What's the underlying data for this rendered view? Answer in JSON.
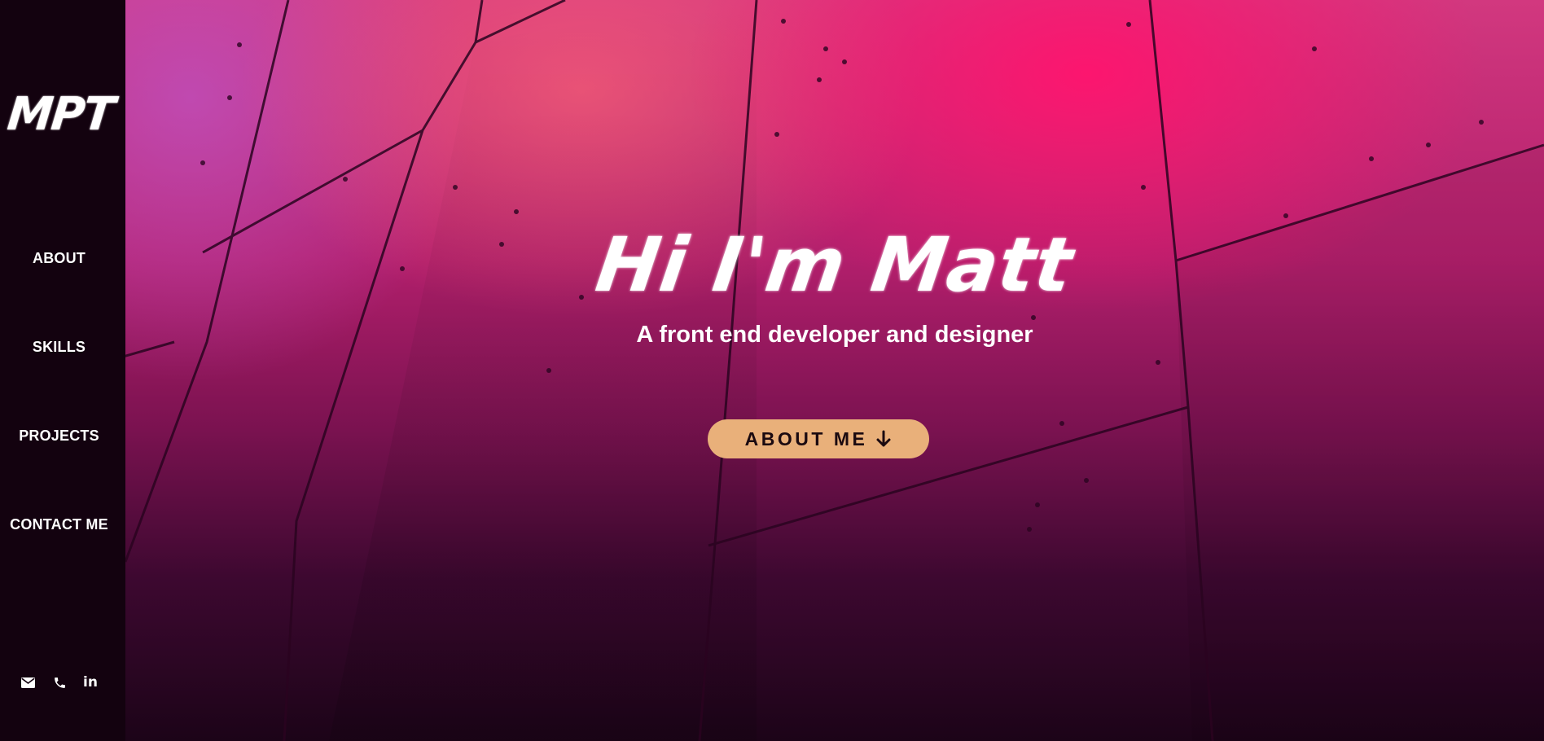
{
  "logo": {
    "text": "MPT"
  },
  "nav": {
    "items": [
      {
        "label": "ABOUT"
      },
      {
        "label": "SKILLS"
      },
      {
        "label": "PROJECTS"
      },
      {
        "label": "CONTACT ME"
      }
    ]
  },
  "social": [
    {
      "icon": "envelope-icon"
    },
    {
      "icon": "phone-icon"
    },
    {
      "icon": "linkedin-icon",
      "glyph": "in"
    }
  ],
  "hero": {
    "title": "Hi I'm Matt",
    "subtitle": "A front end developer and designer",
    "cta_label": "ABOUT ME",
    "cta_icon": "arrow-down-icon"
  },
  "colors": {
    "sidebar_bg": "#13020f",
    "accent_button": "#e9b07a",
    "text": "#ffffff"
  }
}
